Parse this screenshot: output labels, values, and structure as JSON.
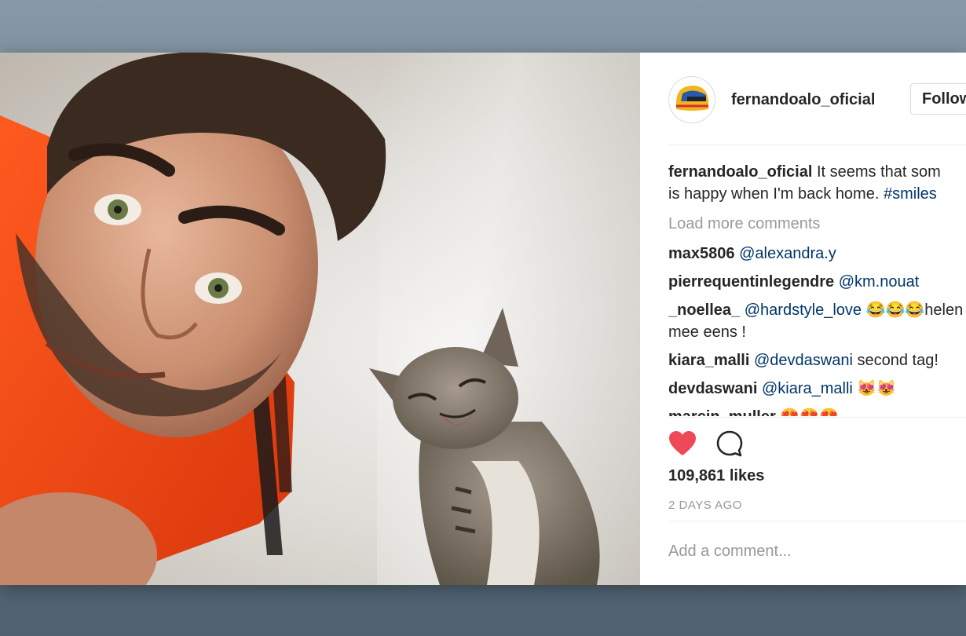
{
  "post": {
    "author": "fernandoalo_oficial",
    "follow_label": "Follow",
    "caption": {
      "user": "fernandoalo_oficial",
      "text_line1": "It seems that som",
      "text_line2": "is happy when I'm back home.",
      "hashtag": "#smiles"
    },
    "load_more_label": "Load more comments",
    "comments": [
      {
        "user": "max5806",
        "mention": "@alexandra.y",
        "text": ""
      },
      {
        "user": "pierrequentinlegendre",
        "mention": "@km.nouat",
        "text": ""
      },
      {
        "user": "_noellea_",
        "mention": "@hardstyle_love",
        "text": "😂😂😂helen",
        "text_line2": "mee eens !"
      },
      {
        "user": "kiara_malli",
        "mention": "@devdaswani",
        "text": "second tag!"
      },
      {
        "user": "devdaswani",
        "mention": "@kiara_malli",
        "text": "😻😻"
      },
      {
        "user": "marcin_muller",
        "mention": "",
        "text": "😍😍😍"
      }
    ],
    "likes": "109,861 likes",
    "timestamp": "2 DAYS AGO",
    "add_comment_placeholder": "Add a comment...",
    "icons": {
      "like": "heart-icon",
      "comment": "comment-bubble-icon"
    },
    "colors": {
      "like_heart": "#ed4956",
      "mention": "#003569",
      "muted": "#999999",
      "text": "#262626"
    }
  }
}
